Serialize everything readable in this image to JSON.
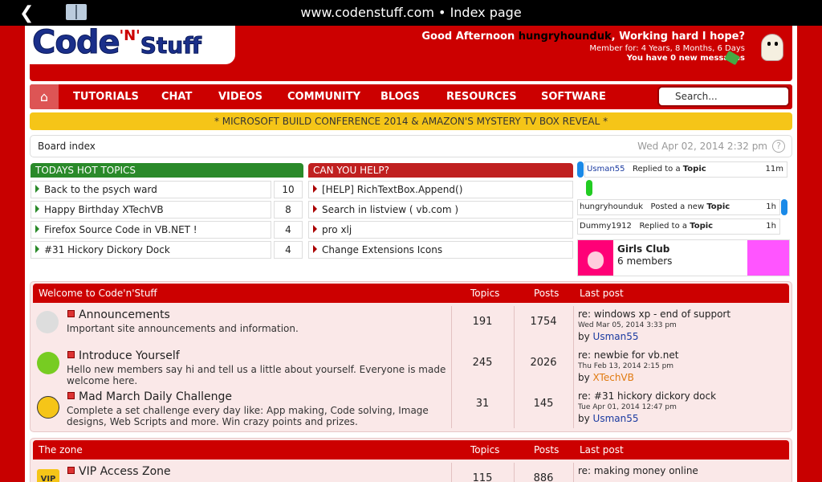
{
  "browser": {
    "url": "www.codenstuff.com • Index page"
  },
  "logo": {
    "part1": "Code",
    "part2": "'N'",
    "part3": "Stuff"
  },
  "greeting": {
    "prefix": "Good Afternoon",
    "user": "hungryhounduk",
    "suffix": ", Working hard I hope?",
    "member_for": "Member for: 4 Years, 8 Months, 6 Days",
    "messages": "You have 0 new messages"
  },
  "nav": {
    "items": [
      "TUTORIALS",
      "CHAT",
      "VIDEOS",
      "COMMUNITY",
      "BLOGS",
      "RESOURCES",
      "SOFTWARE"
    ],
    "search_placeholder": "Search..."
  },
  "banner": "* MICROSOFT BUILD CONFERENCE 2014 & AMAZON'S MYSTERY TV BOX REVEAL *",
  "breadcrumb": {
    "label": "Board index",
    "date": "Wed Apr 02, 2014 2:32 pm",
    "help": "?"
  },
  "hot_topics": {
    "title": "TODAYS HOT TOPICS",
    "items": [
      {
        "title": "Back to the psych ward",
        "count": "10"
      },
      {
        "title": "Happy Birthday XTechVB",
        "count": "8"
      },
      {
        "title": "Firefox Source Code in VB.NET !",
        "count": "4"
      },
      {
        "title": "#31 Hickory Dickory Dock",
        "count": "4"
      }
    ]
  },
  "help_topics": {
    "title": "CAN YOU HELP?",
    "items": [
      "[HELP] RichTextBox.Append()",
      "Search in listview ( vb.com )",
      "pro xlj",
      "Change Extensions Icons"
    ]
  },
  "activity": [
    {
      "user": "Usman55",
      "action": "Replied to a",
      "object": "Topic",
      "time": "11m"
    },
    {
      "user": "hungryhounduk",
      "action": "Posted a new",
      "object": "Topic",
      "time": "1h"
    },
    {
      "user": "Dummy1912",
      "action": "Replied to a",
      "object": "Topic",
      "time": "1h"
    }
  ],
  "club": {
    "name": "Girls Club",
    "members": "6 members"
  },
  "forum1": {
    "title": "Welcome to Code'n'Stuff",
    "col_topics": "Topics",
    "col_posts": "Posts",
    "col_last": "Last post",
    "rows": [
      {
        "name": "Announcements",
        "desc": "Important site announcements and information.",
        "topics": "191",
        "posts": "1754",
        "last": "re: windows xp - end of support",
        "date": "Wed Mar 05, 2014 3:33 pm",
        "by": "by",
        "user": "Usman55"
      },
      {
        "name": "Introduce Yourself",
        "desc": "Hello new members say hi and tell us a little about yourself. Everyone is made welcome here.",
        "topics": "245",
        "posts": "2026",
        "last": "re: newbie for vb.net",
        "date": "Thu Feb 13, 2014 2:15 pm",
        "by": "by",
        "user": "XTechVB"
      },
      {
        "name": "Mad March Daily Challenge",
        "desc": "Complete a set challenge every day like: App making, Code solving, Image designs, Web Scripts and more. Win crazy points and prizes.",
        "topics": "31",
        "posts": "145",
        "last": "re: #31 hickory dickory dock",
        "date": "Tue Apr 01, 2014 12:47 pm",
        "by": "by",
        "user": "Usman55"
      }
    ],
    "icons": {
      "announcements": "megaphone-icon",
      "introduce": "hello-icon",
      "challenge": "smiley-glasses-icon"
    }
  },
  "forum2": {
    "title": "The zone",
    "col_topics": "Topics",
    "col_posts": "Posts",
    "col_last": "Last post",
    "rows": [
      {
        "name": "VIP Access Zone",
        "topics": "115",
        "posts": "886",
        "last": "re: making money online",
        "icon_text": "VIP"
      }
    ]
  },
  "colors": {
    "brand_red": "#c80000",
    "hot_green": "#2a8a2a",
    "help_red": "#c02020",
    "banner_yellow": "#f5c518",
    "link_blue": "#1a3aa0"
  }
}
